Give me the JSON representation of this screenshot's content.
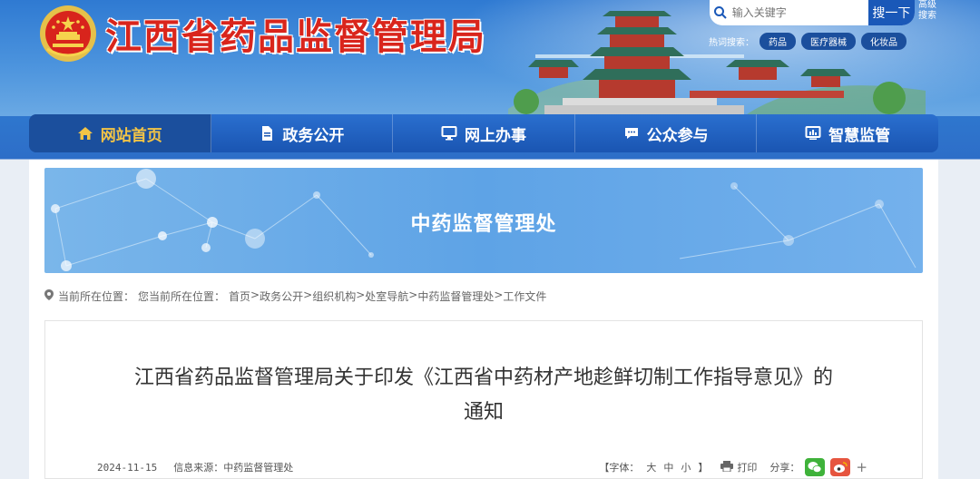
{
  "header": {
    "site_title": "江西省药品监督管理局",
    "search": {
      "placeholder": "输入关键字",
      "button_label": "搜一下",
      "advanced_label": "高级搜索"
    },
    "hot_search": {
      "label": "热词搜索：",
      "tags": [
        "药品",
        "医疗器械",
        "化妆品"
      ]
    }
  },
  "nav": {
    "items": [
      {
        "label": "网站首页",
        "icon": "home-icon"
      },
      {
        "label": "政务公开",
        "icon": "document-icon"
      },
      {
        "label": "网上办事",
        "icon": "monitor-icon"
      },
      {
        "label": "公众参与",
        "icon": "chat-icon"
      },
      {
        "label": "智慧监管",
        "icon": "dashboard-icon"
      }
    ],
    "active_index": 0
  },
  "banner": {
    "title": "中药监督管理处"
  },
  "breadcrumb": {
    "prefix": "当前所在位置：",
    "prefix2": "您当前所在位置：",
    "items": [
      "首页",
      "政务公开",
      "组织机构",
      "处室导航",
      "中药监督管理处",
      "工作文件"
    ],
    "separator": ">"
  },
  "article": {
    "title_line1": "江西省药品监督管理局关于印发《江西省中药材产地趁鲜切制工作指导意见》的",
    "title_line2": "通知",
    "date": "2024-11-15",
    "source": "信息来源：中药监督管理处",
    "font_label": "【字体：",
    "font_sizes": [
      "大",
      "中",
      "小"
    ],
    "font_close": "】",
    "print_label": "打印",
    "share_label": "分享："
  },
  "colors": {
    "title_red": "#d9251c",
    "nav_blue": "#1a55b2",
    "nav_active_text": "#f3c446",
    "banner_blue": "#5ea3e6"
  }
}
